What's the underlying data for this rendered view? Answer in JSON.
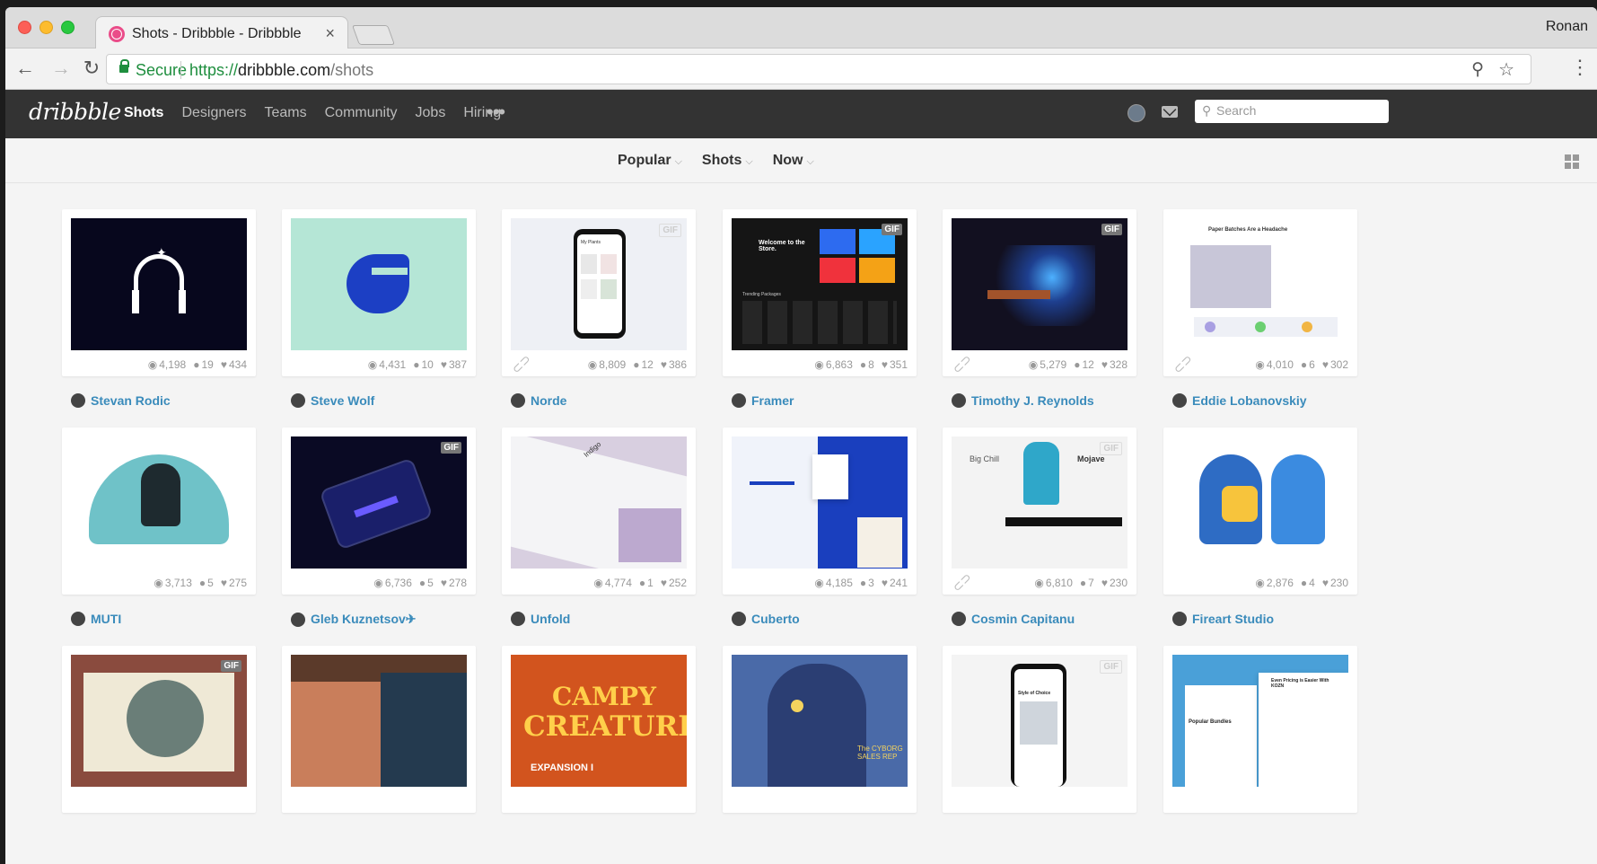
{
  "browser": {
    "tab_title": "Shots - Dribbble - Dribbble",
    "profile_name": "Ronan",
    "secure_label": "Secure",
    "url_scheme": "https://",
    "url_host": "dribbble.com",
    "url_path": "/shots"
  },
  "header": {
    "logo": "dribbble",
    "nav": [
      "Shots",
      "Designers",
      "Teams",
      "Community",
      "Jobs",
      "Hiring"
    ],
    "more": "•••",
    "search_placeholder": "Search"
  },
  "filters": [
    "Popular",
    "Shots",
    "Now"
  ],
  "shots": [
    {
      "author": "Stevan Rodic",
      "views": "4,198",
      "comments": "19",
      "likes": "434",
      "gif": false,
      "link": false,
      "bg": "#07071d"
    },
    {
      "author": "Steve Wolf",
      "views": "4,431",
      "comments": "10",
      "likes": "387",
      "gif": false,
      "link": false,
      "bg": "#b5e6d6"
    },
    {
      "author": "Norde",
      "views": "8,809",
      "comments": "12",
      "likes": "386",
      "gif": true,
      "link": true,
      "bg": "#eef0f5"
    },
    {
      "author": "Framer",
      "views": "6,863",
      "comments": "8",
      "likes": "351",
      "gif": true,
      "link": false,
      "bg": "#151515"
    },
    {
      "author": "Timothy J. Reynolds",
      "views": "5,279",
      "comments": "12",
      "likes": "328",
      "gif": true,
      "link": true,
      "bg": "#121020"
    },
    {
      "author": "Eddie Lobanovskiy",
      "views": "4,010",
      "comments": "6",
      "likes": "302",
      "gif": false,
      "link": true,
      "bg": "#ffffff"
    },
    {
      "author": "MUTI",
      "views": "3,713",
      "comments": "5",
      "likes": "275",
      "gif": false,
      "link": false,
      "bg": "#ffffff"
    },
    {
      "author": "Gleb Kuznetsov✈",
      "views": "6,736",
      "comments": "5",
      "likes": "278",
      "gif": true,
      "link": false,
      "bg": "#0a0a24"
    },
    {
      "author": "Unfold",
      "views": "4,774",
      "comments": "1",
      "likes": "252",
      "gif": false,
      "link": false,
      "bg": "#d8cfe0"
    },
    {
      "author": "Cuberto",
      "views": "4,185",
      "comments": "3",
      "likes": "241",
      "gif": false,
      "link": false,
      "bg": "#f0f3fa"
    },
    {
      "author": "Cosmin Capitanu",
      "views": "6,810",
      "comments": "7",
      "likes": "230",
      "gif": true,
      "link": true,
      "bg": "#f3f3f3"
    },
    {
      "author": "Fireart Studio",
      "views": "2,876",
      "comments": "4",
      "likes": "230",
      "gif": false,
      "link": false,
      "bg": "#ffffff"
    },
    {
      "author": "",
      "views": "",
      "comments": "",
      "likes": "",
      "gif": true,
      "link": false,
      "bg": "#8a4b3e"
    },
    {
      "author": "",
      "views": "",
      "comments": "",
      "likes": "",
      "gif": false,
      "link": false,
      "bg": "#5b3a2a"
    },
    {
      "author": "",
      "views": "",
      "comments": "",
      "likes": "",
      "gif": false,
      "link": false,
      "bg": "#d2541e"
    },
    {
      "author": "",
      "views": "",
      "comments": "",
      "likes": "",
      "gif": false,
      "link": false,
      "bg": "#4a6aa8"
    },
    {
      "author": "",
      "views": "",
      "comments": "",
      "likes": "",
      "gif": true,
      "link": false,
      "bg": "#f4f4f4"
    },
    {
      "author": "",
      "views": "",
      "comments": "",
      "likes": "",
      "gif": false,
      "link": false,
      "bg": "#eaf2fb"
    }
  ],
  "thumb_text": {
    "framer_welcome": "Welcome to the Store.",
    "framer_trending": "Trending Packages",
    "norde_title": "My Plants",
    "eddie_title": "Paper Batches Are a Headache",
    "indigo": "Indigo",
    "campy": "CAMPY",
    "creatures": "CREATURES",
    "expansion": "EXPANSION I",
    "cyborg": "The CYBORG SALES REP",
    "bigchill": "Big Chill",
    "mojave": "Mojave",
    "style": "Style of Choice",
    "bundles": "Popular Bundles",
    "pricing": "Even Pricing is Easier With KOZN"
  },
  "gif_label": "GIF",
  "colors": {
    "accent": "#ea4c89",
    "link": "#3a8bbb",
    "header": "#333333"
  }
}
